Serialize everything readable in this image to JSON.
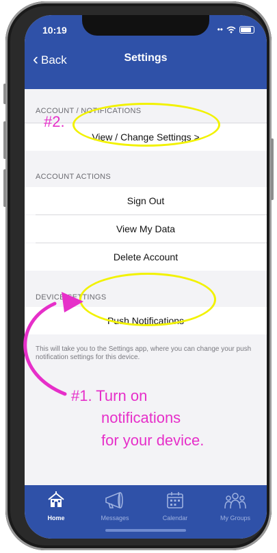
{
  "status": {
    "time": "10:19"
  },
  "nav": {
    "back_label": "Back",
    "title": "Settings"
  },
  "sections": {
    "account_notifications": {
      "header": "ACCOUNT / NOTIFICATIONS",
      "item": "View / Change Settings >"
    },
    "account_actions": {
      "header": "ACCOUNT ACTIONS",
      "items": [
        "Sign Out",
        "View My Data",
        "Delete Account"
      ]
    },
    "device_settings": {
      "header": "DEVICE SETTINGS",
      "item": "Push Notifications",
      "note": "This will take you to the Settings app, where you can change your push notification settings for this device."
    }
  },
  "tabs": [
    {
      "label": "Home",
      "icon": "house-icon",
      "active": true
    },
    {
      "label": "Messages",
      "icon": "megaphone-icon",
      "active": false
    },
    {
      "label": "Calendar",
      "icon": "calendar-icon",
      "active": false
    },
    {
      "label": "My Groups",
      "icon": "group-icon",
      "active": false
    }
  ],
  "annotations": {
    "step2": "#2.",
    "step1_line1": "#1. Turn on",
    "step1_line2": "notifications",
    "step1_line3": "for your device."
  },
  "colors": {
    "nav_blue": "#2f51a8",
    "highlight_yellow": "#f2f200",
    "annotation_magenta": "#e62fc9"
  }
}
